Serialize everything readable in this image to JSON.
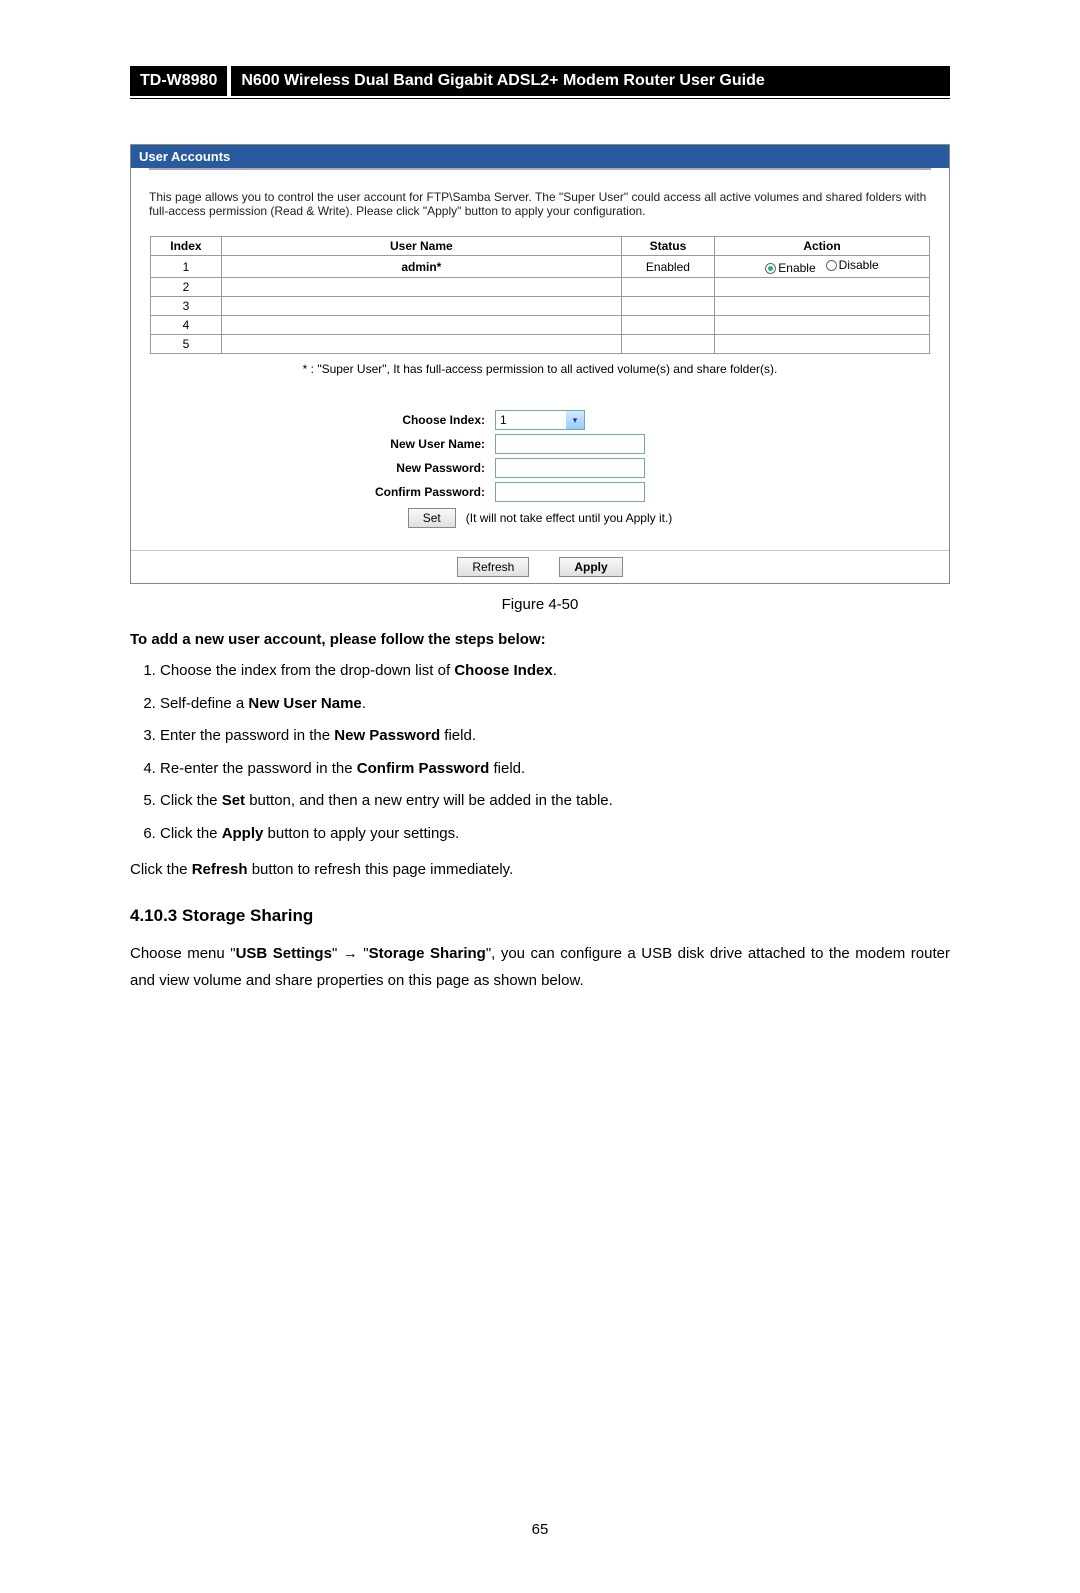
{
  "header": {
    "model": "TD-W8980",
    "title": "N600 Wireless Dual Band Gigabit ADSL2+ Modem Router User Guide"
  },
  "screenshot": {
    "section_title": "User Accounts",
    "intro": "This page allows you to control the user account for FTP\\Samba Server. The \"Super User\" could access all active volumes and shared folders with full-access permission (Read & Write). Please click \"Apply\" button to apply your configuration.",
    "table": {
      "headers": {
        "index": "Index",
        "username": "User Name",
        "status": "Status",
        "action": "Action"
      },
      "rows": [
        {
          "index": "1",
          "username": "admin*",
          "status": "Enabled",
          "enable": "Enable",
          "disable": "Disable",
          "selected": "enable"
        },
        {
          "index": "2",
          "username": "",
          "status": "",
          "enable": "",
          "disable": ""
        },
        {
          "index": "3",
          "username": "",
          "status": "",
          "enable": "",
          "disable": ""
        },
        {
          "index": "4",
          "username": "",
          "status": "",
          "enable": "",
          "disable": ""
        },
        {
          "index": "5",
          "username": "",
          "status": "",
          "enable": "",
          "disable": ""
        }
      ],
      "footnote": "* : \"Super User\", It has full-access permission to all actived volume(s) and share folder(s)."
    },
    "form": {
      "choose_index_label": "Choose Index:",
      "choose_index_value": "1",
      "new_user_label": "New User Name:",
      "new_password_label": "New Password:",
      "confirm_password_label": "Confirm Password:",
      "set_button": "Set",
      "set_note": "(It will not take effect until you Apply it.)",
      "refresh_button": "Refresh",
      "apply_button": "Apply"
    }
  },
  "figure_caption": "Figure 4-50",
  "instructions": {
    "heading": "To add a new user account, please follow the steps below:",
    "steps": [
      {
        "pre": "Choose the index from the drop-down list of ",
        "bold": "Choose Index",
        "post": "."
      },
      {
        "pre": "Self-define a ",
        "bold": "New User Name",
        "post": "."
      },
      {
        "pre": "Enter the password in the ",
        "bold": "New Password",
        "post": " field."
      },
      {
        "pre": "Re-enter the password in the ",
        "bold": "Confirm Password",
        "post": " field."
      },
      {
        "pre": "Click the ",
        "bold": "Set",
        "post": " button, and then a new entry will be added in the table."
      },
      {
        "pre": "Click the ",
        "bold": "Apply",
        "post": " button to apply your settings."
      }
    ],
    "refresh_line_pre": "Click the ",
    "refresh_line_bold": "Refresh",
    "refresh_line_post": " button to refresh this page immediately."
  },
  "subsection": {
    "heading": "4.10.3 Storage Sharing",
    "p_pre": "Choose menu \"",
    "p_b1": "USB Settings",
    "p_arrow": "\" → \"",
    "p_b2": "Storage Sharing",
    "p_post": "\", you can configure a USB disk drive attached to the modem router and view volume and share properties on this page as shown below."
  },
  "page_number": "65"
}
